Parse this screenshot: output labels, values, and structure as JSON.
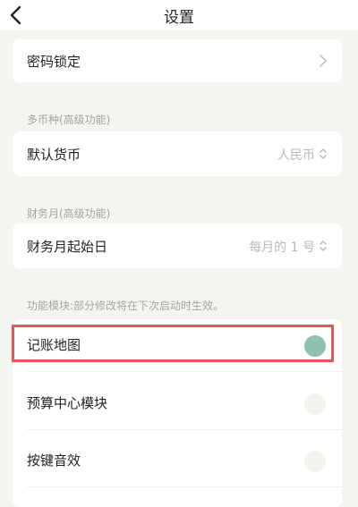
{
  "header": {
    "title": "设置",
    "back_icon": "chevron-left-icon"
  },
  "password_lock": {
    "label": "密码锁定",
    "icon": "chevron-right-icon"
  },
  "multi_currency": {
    "section_label": "多币种(高级功能)",
    "label": "默认货币",
    "value": "人民币",
    "icon": "up-down-icon"
  },
  "finance_month": {
    "section_label": "财务月(高级功能)",
    "label": "财务月起始日",
    "value": "每月的 1 号",
    "icon": "up-down-icon"
  },
  "modules": {
    "section_label": "功能模块:部分修改将在下次启动时生效。",
    "items": [
      {
        "label": "记账地图",
        "enabled": true
      },
      {
        "label": "预算中心模块",
        "enabled": false
      },
      {
        "label": "按键音效",
        "enabled": false
      }
    ]
  },
  "colors": {
    "accent": "#8fbfae",
    "highlight_border": "#e0585a",
    "background": "#f4f4f1"
  }
}
